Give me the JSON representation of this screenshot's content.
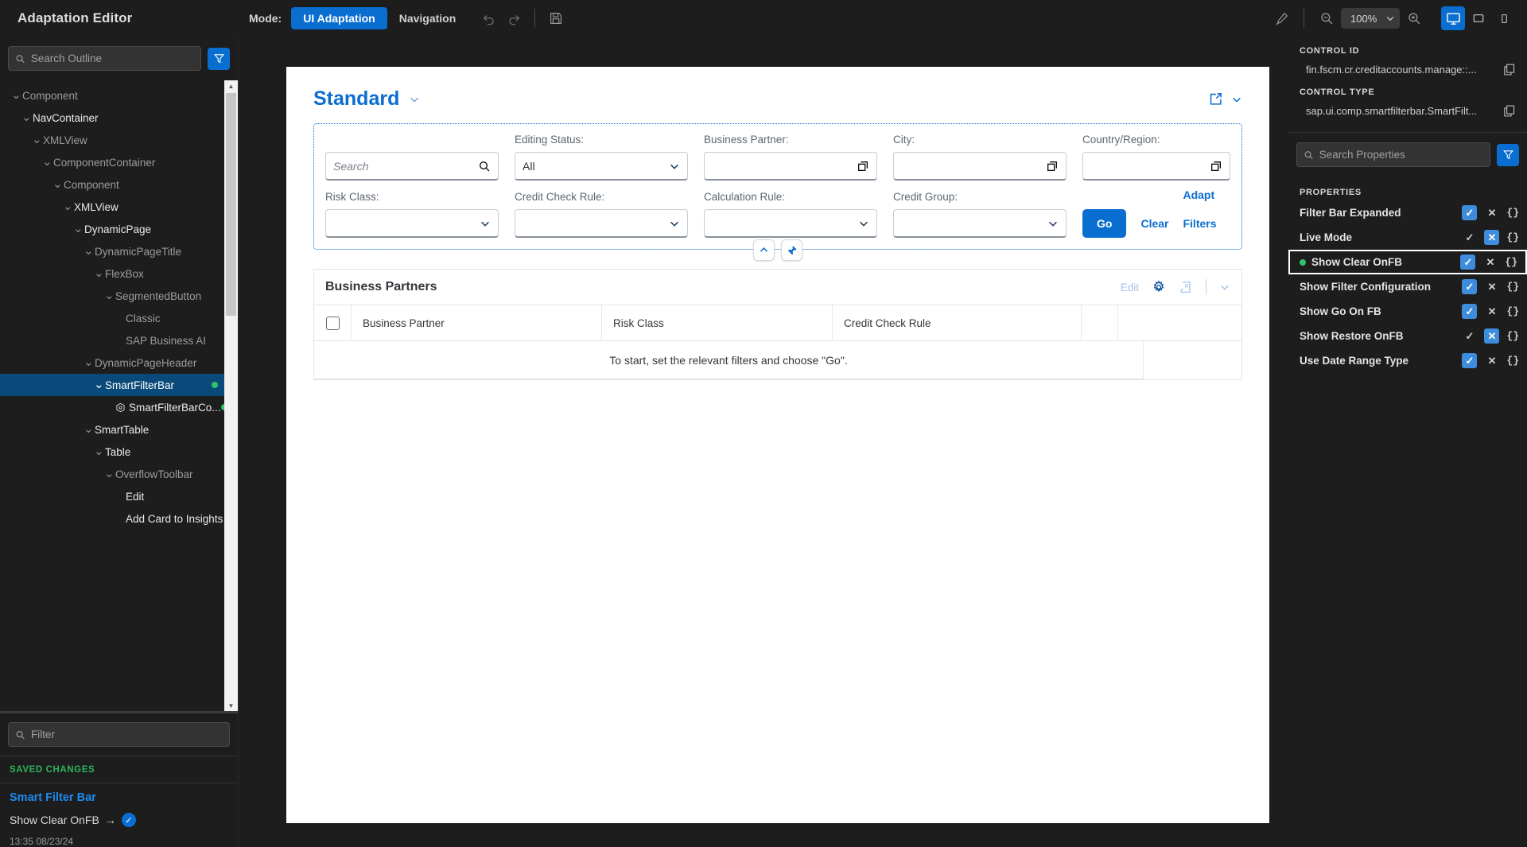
{
  "topbar": {
    "app_title": "Adaptation Editor",
    "mode_label": "Mode:",
    "modes": [
      {
        "label": "UI Adaptation",
        "active": true
      },
      {
        "label": "Navigation",
        "active": false
      }
    ],
    "undo_icon": "undo-icon",
    "redo_icon": "redo-icon",
    "save_icon": "save-icon",
    "highlight_icon": "highlight-icon",
    "zoom_out_icon": "zoom-out-icon",
    "zoom_in_icon": "zoom-in-icon",
    "zoom_level": "100%",
    "devices": [
      {
        "name": "desktop-device-button",
        "active": true
      },
      {
        "name": "tablet-device-button",
        "active": false
      },
      {
        "name": "phone-device-button",
        "active": false
      }
    ]
  },
  "outline": {
    "search_placeholder": "Search Outline",
    "search_value": "",
    "filter_icon": "filter-icon",
    "nodes": [
      {
        "label": "Component",
        "depth": 0,
        "caret": true,
        "bright": false,
        "selected": false,
        "dot": false,
        "icon": null
      },
      {
        "label": "NavContainer",
        "depth": 1,
        "caret": true,
        "bright": true,
        "selected": false,
        "dot": false,
        "icon": null
      },
      {
        "label": "XMLView",
        "depth": 2,
        "caret": true,
        "bright": false,
        "selected": false,
        "dot": false,
        "icon": null
      },
      {
        "label": "ComponentContainer",
        "depth": 3,
        "caret": true,
        "bright": false,
        "selected": false,
        "dot": false,
        "icon": null
      },
      {
        "label": "Component",
        "depth": 4,
        "caret": true,
        "bright": false,
        "selected": false,
        "dot": false,
        "icon": null
      },
      {
        "label": "XMLView",
        "depth": 5,
        "caret": true,
        "bright": true,
        "selected": false,
        "dot": false,
        "icon": null
      },
      {
        "label": "DynamicPage",
        "depth": 6,
        "caret": true,
        "bright": true,
        "selected": false,
        "dot": false,
        "icon": null
      },
      {
        "label": "DynamicPageTitle",
        "depth": 7,
        "caret": true,
        "bright": false,
        "selected": false,
        "dot": false,
        "icon": null
      },
      {
        "label": "FlexBox",
        "depth": 8,
        "caret": true,
        "bright": false,
        "selected": false,
        "dot": false,
        "icon": null
      },
      {
        "label": "SegmentedButton",
        "depth": 9,
        "caret": true,
        "bright": false,
        "selected": false,
        "dot": false,
        "icon": null
      },
      {
        "label": "Classic",
        "depth": 10,
        "caret": false,
        "bright": false,
        "selected": false,
        "dot": false,
        "icon": null
      },
      {
        "label": "SAP Business AI",
        "depth": 10,
        "caret": false,
        "bright": false,
        "selected": false,
        "dot": false,
        "icon": null
      },
      {
        "label": "DynamicPageHeader",
        "depth": 7,
        "caret": true,
        "bright": false,
        "selected": false,
        "dot": false,
        "icon": null
      },
      {
        "label": "SmartFilterBar",
        "depth": 8,
        "caret": true,
        "bright": true,
        "selected": true,
        "dot": true,
        "icon": null
      },
      {
        "label": "SmartFilterBarCo...",
        "depth": 9,
        "caret": false,
        "bright": true,
        "selected": false,
        "dot": true,
        "icon": "cube-icon"
      },
      {
        "label": "SmartTable",
        "depth": 7,
        "caret": true,
        "bright": true,
        "selected": false,
        "dot": false,
        "icon": null
      },
      {
        "label": "Table",
        "depth": 8,
        "caret": true,
        "bright": true,
        "selected": false,
        "dot": false,
        "icon": null
      },
      {
        "label": "OverflowToolbar",
        "depth": 9,
        "caret": true,
        "bright": false,
        "selected": false,
        "dot": false,
        "icon": null
      },
      {
        "label": "Edit",
        "depth": 10,
        "caret": false,
        "bright": true,
        "selected": false,
        "dot": false,
        "icon": null
      },
      {
        "label": "Add Card to Insights",
        "depth": 10,
        "caret": false,
        "bright": true,
        "selected": false,
        "dot": false,
        "icon": null
      }
    ]
  },
  "changes": {
    "filter_placeholder": "Filter",
    "filter_value": "",
    "saved_header": "SAVED CHANGES",
    "items": [
      {
        "title": "Smart Filter Bar",
        "property": "Show Clear OnFB",
        "arrow": "→",
        "value_icon": "checkmark-circle-icon",
        "timestamp": "13:35 08/23/24"
      }
    ]
  },
  "app_preview": {
    "variant_title": "Standard",
    "variant_caret_icon": "chevron-down-icon",
    "share_icon": "share-icon",
    "share_caret_icon": "chevron-down-icon",
    "filter_bar": {
      "search": {
        "placeholder": "Search",
        "value": "",
        "icon": "search-icon"
      },
      "fields": [
        {
          "label": "Editing Status:",
          "value": "All",
          "type": "select"
        },
        {
          "label": "Business Partner:",
          "value": "",
          "type": "valuehelp"
        },
        {
          "label": "City:",
          "value": "",
          "type": "valuehelp"
        },
        {
          "label": "Country/Region:",
          "value": "",
          "type": "valuehelp"
        },
        {
          "label": "Risk Class:",
          "value": "",
          "type": "select"
        },
        {
          "label": "Credit Check Rule:",
          "value": "",
          "type": "select"
        },
        {
          "label": "Calculation Rule:",
          "value": "",
          "type": "select"
        },
        {
          "label": "Credit Group:",
          "value": "",
          "type": "select"
        }
      ],
      "go_label": "Go",
      "clear_label": "Clear",
      "adapt_label": "Adapt Filters"
    },
    "collapse_icon": "chevron-up-icon",
    "pin_icon": "pin-icon",
    "table": {
      "title": "Business Partners",
      "edit_label": "Edit",
      "settings_icon": "gear-icon",
      "personalize_icon": "table-personalization-icon",
      "overflow_icon": "chevron-down-icon",
      "columns": [
        "Business Partner",
        "Risk Class",
        "Credit Check Rule"
      ],
      "empty_text": "To start, set the relevant filters and choose \"Go\"."
    }
  },
  "properties_panel": {
    "control_id_label": "CONTROL ID",
    "control_id_value": "fin.fscm.cr.creditaccounts.manage::...",
    "control_type_label": "CONTROL TYPE",
    "control_type_value": "sap.ui.comp.smartfilterbar.SmartFilt...",
    "copy_icon": "copy-icon",
    "search_placeholder": "Search Properties",
    "search_value": "",
    "filter_icon": "filter-icon",
    "properties_header": "PROPERTIES",
    "items": [
      {
        "label": "Filter Bar Expanded",
        "check_on": true,
        "cross_on": false,
        "modified": false,
        "highlighted": false,
        "braces": "{}"
      },
      {
        "label": "Live Mode",
        "check_on": false,
        "cross_on": true,
        "modified": false,
        "highlighted": false,
        "braces": "{}"
      },
      {
        "label": "Show Clear OnFB",
        "check_on": true,
        "cross_on": false,
        "modified": true,
        "highlighted": true,
        "braces": "{}"
      },
      {
        "label": "Show Filter Configuration",
        "check_on": true,
        "cross_on": false,
        "modified": false,
        "highlighted": false,
        "braces": "{}"
      },
      {
        "label": "Show Go On FB",
        "check_on": true,
        "cross_on": false,
        "modified": false,
        "highlighted": false,
        "braces": "{}"
      },
      {
        "label": "Show Restore OnFB",
        "check_on": false,
        "cross_on": true,
        "modified": false,
        "highlighted": false,
        "braces": "{}"
      },
      {
        "label": "Use Date Range Type",
        "check_on": true,
        "cross_on": false,
        "modified": false,
        "highlighted": false,
        "braces": "{}"
      }
    ]
  },
  "colors": {
    "accent": "#0a6ed1",
    "panel_bg": "#1d1d1d",
    "selection": "#0a4a7a",
    "modified_dot": "#30c26b",
    "saved_header": "#2eb35c"
  }
}
